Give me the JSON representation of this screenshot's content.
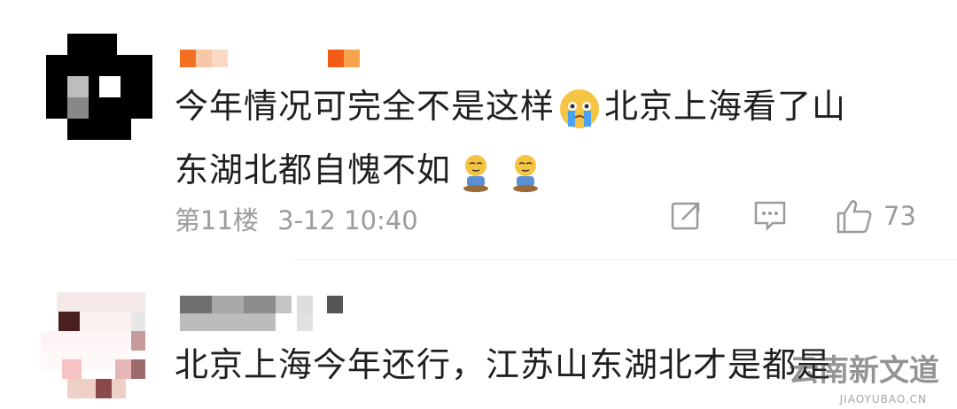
{
  "comments": [
    {
      "text_line1": "今年情况可完全不是这样",
      "text_line1_after": "北京上海看了山",
      "text_line2": "东湖北都自愧不如",
      "floor": "第11楼",
      "time": "3-12 10:40",
      "like_count": "73",
      "emojis": [
        "crying-face-emoji",
        "kneeling-sweat-emoji",
        "kneeling-sweat-emoji"
      ]
    },
    {
      "text": "北京上海今年还行，江苏山东湖北才是都是"
    }
  ],
  "watermark": {
    "brand": "云南新文道",
    "url": "JIAOYUBAO.CN"
  },
  "colors": {
    "text": "#1f1f1f",
    "meta": "#9b9b9b",
    "name_orange": "#f37021"
  }
}
